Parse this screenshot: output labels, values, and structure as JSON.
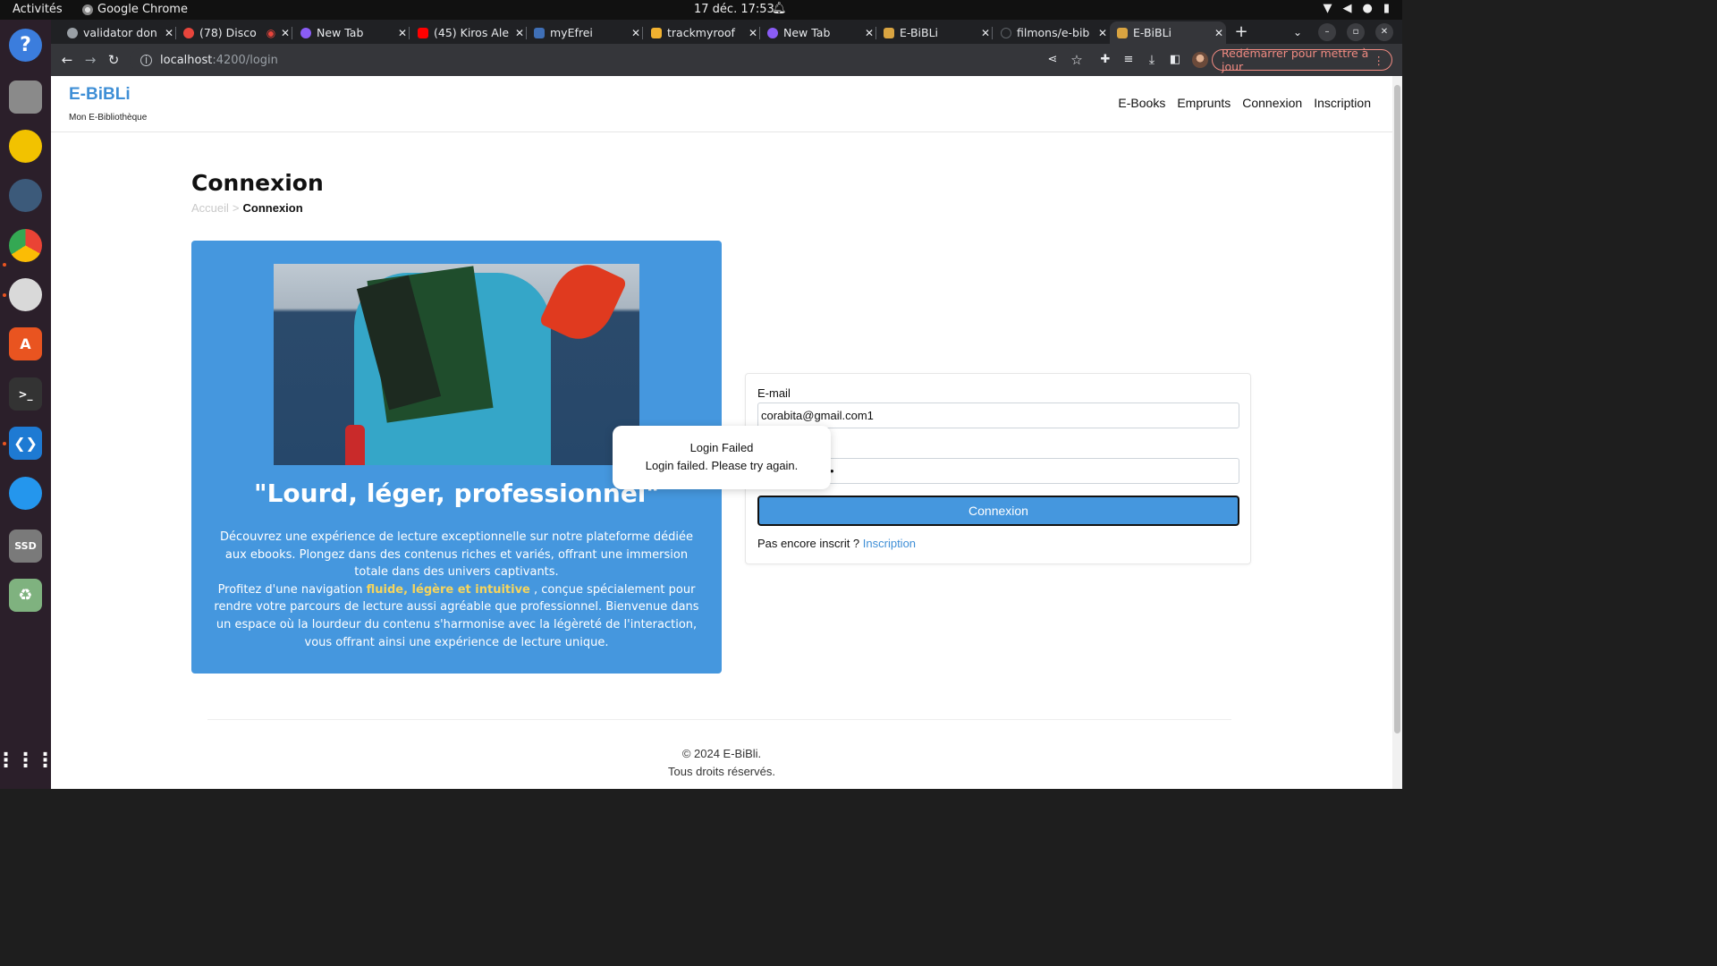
{
  "os": {
    "activities": "Activités",
    "app_name": "Google Chrome",
    "clock": "17 déc.  17:53"
  },
  "browser": {
    "tabs": [
      {
        "title": "validator don",
        "favicon_color": "#9aa0a6",
        "active": false
      },
      {
        "title": "(78) Disco",
        "favicon_color": "#e8453c",
        "active": false
      },
      {
        "title": "New Tab",
        "favicon_color": "#8a5cf6",
        "active": false
      },
      {
        "title": "(45) Kiros Ale",
        "favicon_color": "#ff0000",
        "active": false
      },
      {
        "title": "myEfrei",
        "favicon_color": "#3f6fb6",
        "active": false
      },
      {
        "title": "trackmyroof",
        "favicon_color": "#f2b230",
        "active": false
      },
      {
        "title": "New Tab",
        "favicon_color": "#8a5cf6",
        "active": false
      },
      {
        "title": "E-BiBLi",
        "favicon_color": "#d9a441",
        "active": false
      },
      {
        "title": "filmons/e-bib",
        "favicon_color": "#202124",
        "active": false
      },
      {
        "title": "E-BiBLi",
        "favicon_color": "#d9a441",
        "active": true
      }
    ],
    "url_host": "localhost",
    "url_path": ":4200/login",
    "update_button": "Redémarrer pour mettre à jour"
  },
  "site": {
    "brand": "E-BiBLi",
    "tagline": "Mon E-Bibliothèque",
    "nav": [
      "E-Books",
      "Emprunts",
      "Connexion",
      "Inscription"
    ]
  },
  "page": {
    "title": "Connexion",
    "breadcrumb_home": "Accueil",
    "breadcrumb_sep": ">",
    "breadcrumb_current": "Connexion"
  },
  "promo": {
    "quote": "\"Lourd, léger, professionnel\"",
    "p1": "Découvrez une expérience de lecture exceptionnelle sur notre plateforme dédiée aux ebooks. Plongez dans des contenus riches et variés, offrant une immersion totale dans des univers captivants.",
    "p2_before": "Profitez d'une navigation ",
    "p2_highlight": "fluide, légère et intuitive",
    "p2_after": " , conçue spécialement pour rendre votre parcours de lecture aussi agréable que professionnel. Bienvenue dans un espace où la lourdeur du contenu s'harmonise avec la légèreté de l'interaction, vous offrant ainsi une expérience de lecture unique."
  },
  "form": {
    "email_label": "E-mail",
    "email_value": "corabita@gmail.com1",
    "password_value": "•",
    "submit": "Connexion",
    "signup_prompt": "Pas encore inscrit ? ",
    "signup_link": "Inscription"
  },
  "toast": {
    "title": "Login Failed",
    "message": "Login failed. Please try again."
  },
  "footer": {
    "copyright": "© 2024 E-BiBli.",
    "rights": "Tous droits réservés."
  },
  "colors": {
    "accent": "#4597de",
    "brand": "#3f8fd6",
    "highlight": "#f6d55c"
  }
}
